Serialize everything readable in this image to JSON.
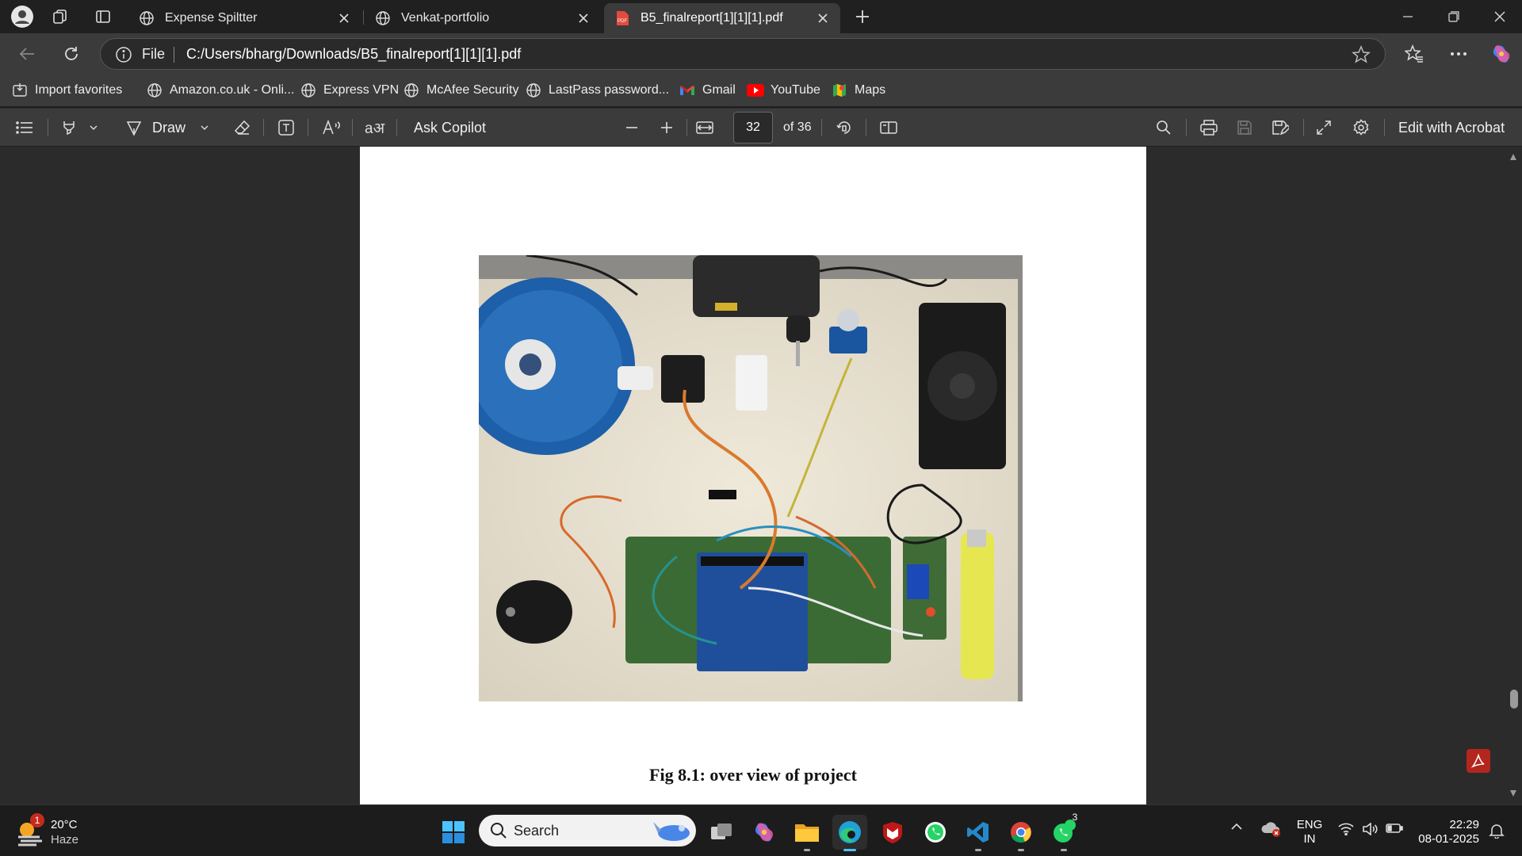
{
  "browser": {
    "tabs": [
      {
        "title": "Expense Spiltter",
        "active": false
      },
      {
        "title": "Venkat-portfolio",
        "active": false
      },
      {
        "title": "B5_finalreport[1][1][1].pdf",
        "active": true
      }
    ],
    "address": {
      "scheme_label": "File",
      "url": "C:/Users/bharg/Downloads/B5_finalreport[1][1][1].pdf"
    },
    "favorites": [
      {
        "label": "Import favorites",
        "icon": "import-icon"
      },
      {
        "label": "Amazon.co.uk - Onli...",
        "icon": "globe-icon"
      },
      {
        "label": "Express VPN",
        "icon": "globe-icon"
      },
      {
        "label": "McAfee Security",
        "icon": "globe-icon"
      },
      {
        "label": "LastPass password...",
        "icon": "globe-icon"
      },
      {
        "label": "Gmail",
        "icon": "gmail-icon"
      },
      {
        "label": "YouTube",
        "icon": "youtube-icon"
      },
      {
        "label": "Maps",
        "icon": "maps-icon"
      }
    ]
  },
  "pdf_toolbar": {
    "draw_label": "Draw",
    "ask_copilot_label": "Ask Copilot",
    "current_page": "32",
    "total_pages_label": "of 36",
    "edit_with_acrobat_label": "Edit with Acrobat"
  },
  "document": {
    "figure_caption": "Fig 8.1: over view of project"
  },
  "taskbar": {
    "weather": {
      "temperature": "20°C",
      "condition": "Haze",
      "badge": "1"
    },
    "search_label": "Search",
    "whatsapp_badge": "3",
    "language_line1": "ENG",
    "language_line2": "IN",
    "time": "22:29",
    "date": "08-01-2025"
  }
}
